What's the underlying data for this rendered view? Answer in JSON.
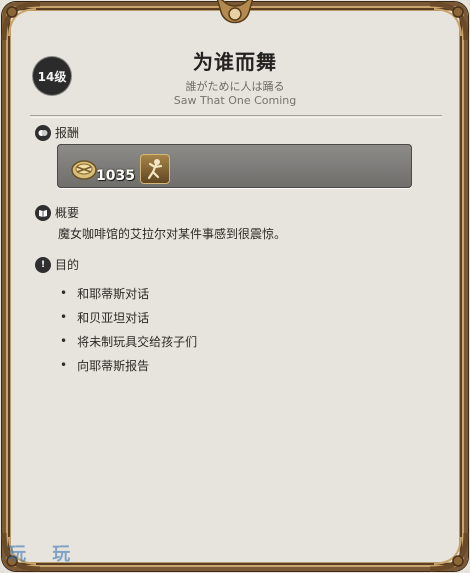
{
  "quest": {
    "level": "14级",
    "title": "为谁而舞",
    "title_jp": "誰がために人は踊る",
    "title_en": "Saw That One Coming"
  },
  "rewards": {
    "heading": "报酬",
    "gil_amount": "1035",
    "gil_icon": "gil-coin-icon",
    "item_icon": "dancer-emote-icon"
  },
  "summary": {
    "heading": "概要",
    "text": "魔女咖啡馆的艾拉尔对某件事感到很震惊。"
  },
  "objectives": {
    "heading": "目的",
    "items": [
      "和耶蒂斯对话",
      "和贝亚坦对话",
      "将未制玩具交给孩子们",
      "向耶蒂斯报告"
    ]
  },
  "watermark": "玩 玩",
  "colors": {
    "frame": "#7a5a36",
    "panel": "#e6e4dd",
    "badge": "#2b2b2b",
    "reward_box": "#7e7d7a"
  }
}
